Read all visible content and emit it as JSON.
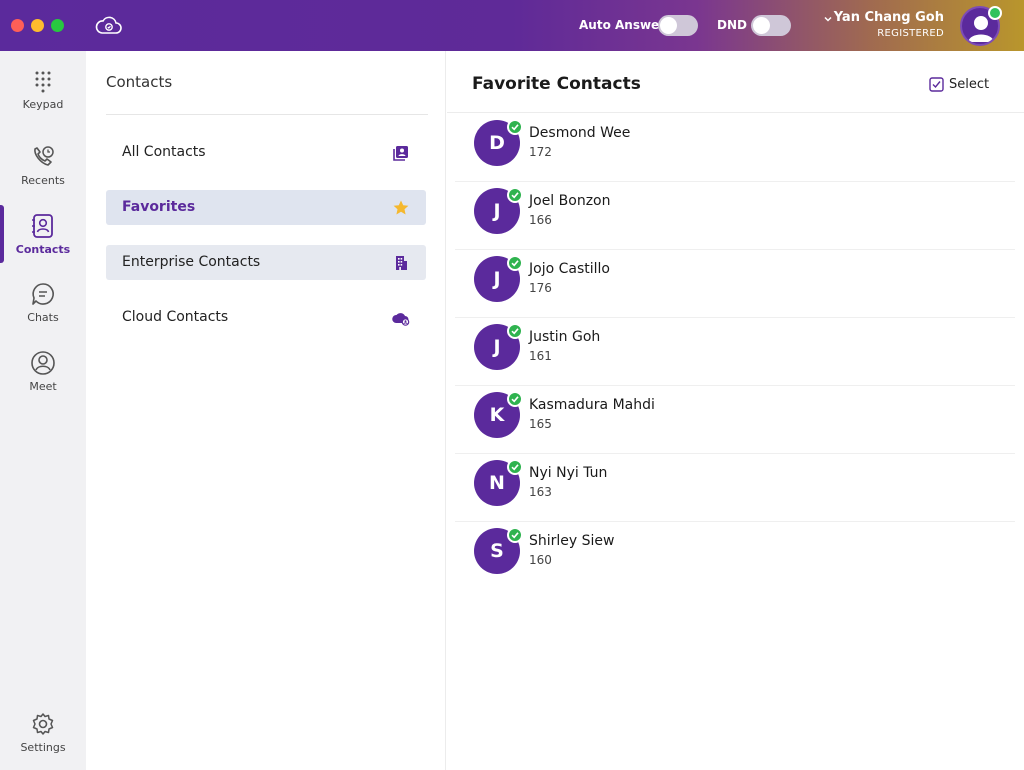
{
  "titlebar": {
    "auto_answer_label": "Auto Answer",
    "dnd_label": "DND",
    "user_name": "Yan Chang Goh",
    "user_status": "REGISTERED",
    "brand_color": "#5b2a9c",
    "presence_color": "#2fc25b"
  },
  "nav": {
    "keypad": "Keypad",
    "recents": "Recents",
    "contacts": "Contacts",
    "chats": "Chats",
    "meet": "Meet",
    "settings": "Settings"
  },
  "contacts_panel": {
    "title": "Contacts",
    "categories": [
      {
        "label": "All Contacts",
        "icon": "contact-book-icon"
      },
      {
        "label": "Favorites",
        "icon": "star-icon"
      },
      {
        "label": "Enterprise Contacts",
        "icon": "building-icon"
      },
      {
        "label": "Cloud Contacts",
        "icon": "cloud-user-icon"
      }
    ]
  },
  "favorites": {
    "title": "Favorite Contacts",
    "select_label": "Select",
    "contacts": [
      {
        "initial": "D",
        "name": "Desmond Wee",
        "ext": "172"
      },
      {
        "initial": "J",
        "name": "Joel Bonzon",
        "ext": "166"
      },
      {
        "initial": "J",
        "name": "Jojo Castillo",
        "ext": "176"
      },
      {
        "initial": "J",
        "name": "Justin Goh",
        "ext": "161"
      },
      {
        "initial": "K",
        "name": "Kasmadura Mahdi",
        "ext": "165"
      },
      {
        "initial": "N",
        "name": "Nyi Nyi Tun",
        "ext": "163"
      },
      {
        "initial": "S",
        "name": "Shirley Siew",
        "ext": "160"
      }
    ]
  }
}
